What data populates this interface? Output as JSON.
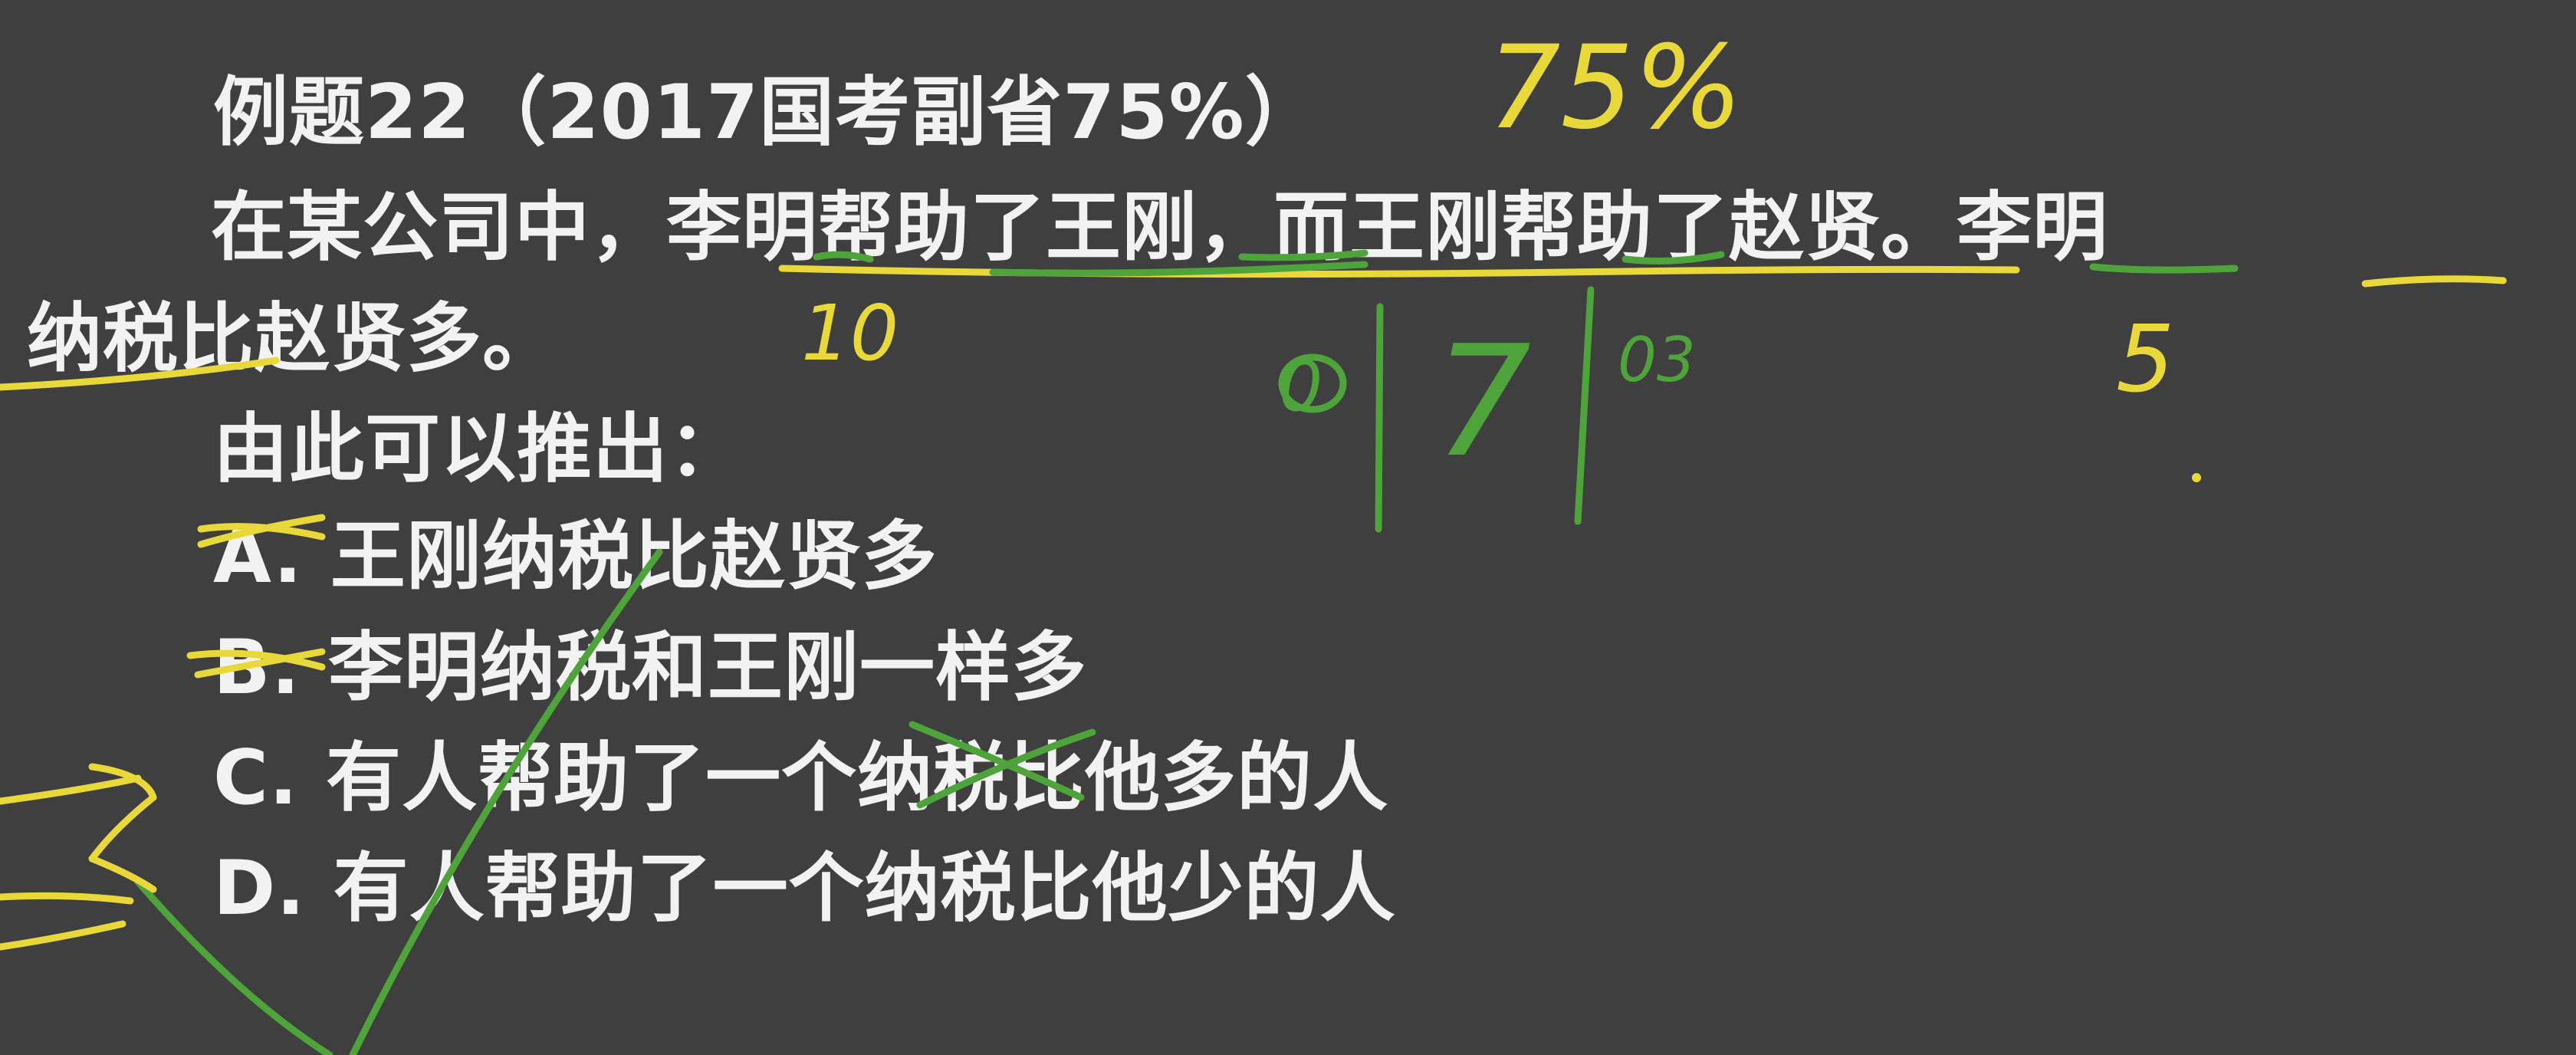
{
  "question": {
    "title": "例题22（2017国考副省75%）",
    "stem_line1": "在某公司中，李明帮助了王刚，而王刚帮助了赵贤。李明",
    "stem_line2": "纳税比赵贤多。",
    "prompt": "由此可以推出：",
    "options": [
      {
        "letter": "A.",
        "text": "王刚纳税比赵贤多"
      },
      {
        "letter": "B.",
        "text": "李明纳税和王刚一样多"
      },
      {
        "letter": "C.",
        "text": "有人帮助了一个纳税比他多的人"
      },
      {
        "letter": "D.",
        "text": "有人帮助了一个纳税比他少的人"
      }
    ]
  },
  "annotations": {
    "rate": "75%",
    "ten": "10",
    "five": "5",
    "seven": "7",
    "zero": "0",
    "small": "03",
    "colors": {
      "yellow": "#e9d83a",
      "green": "#4ea33a"
    }
  }
}
